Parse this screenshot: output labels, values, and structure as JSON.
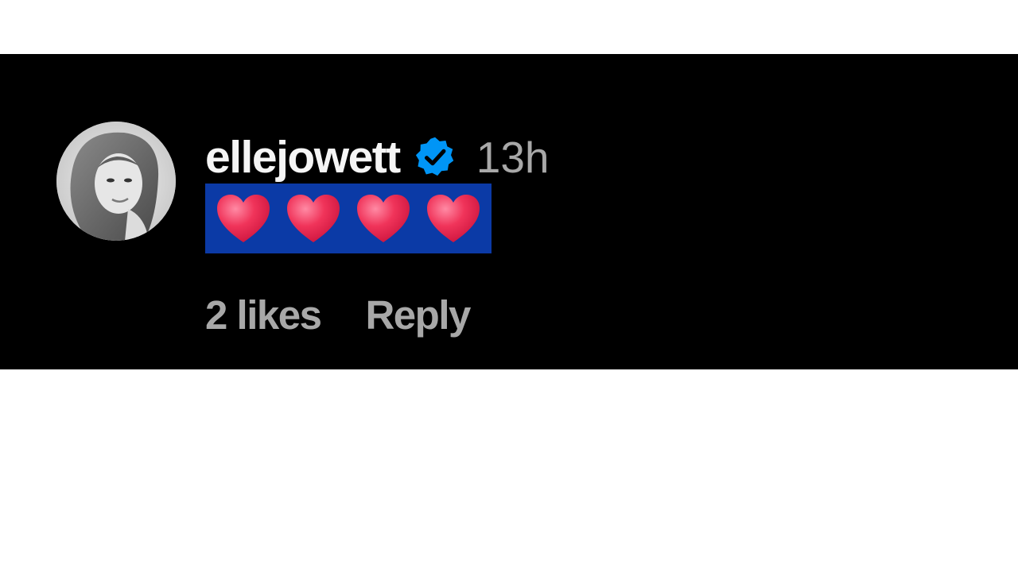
{
  "comment": {
    "username": "ellejowett",
    "verified": true,
    "timestamp": "13h",
    "content_emoji": [
      "red-heart",
      "red-heart",
      "red-heart",
      "red-heart"
    ],
    "likes_label": "2 likes",
    "reply_label": "Reply"
  },
  "colors": {
    "card_background": "#000000",
    "page_background": "#ffffff",
    "username": "#f5f5f5",
    "secondary_text": "#a8a8a8",
    "verified_badge": "#0095f6",
    "highlight": "#0b3aa6",
    "heart": "#f0345a"
  },
  "icons": {
    "verified": "verified-badge-icon",
    "heart": "heart-icon"
  }
}
